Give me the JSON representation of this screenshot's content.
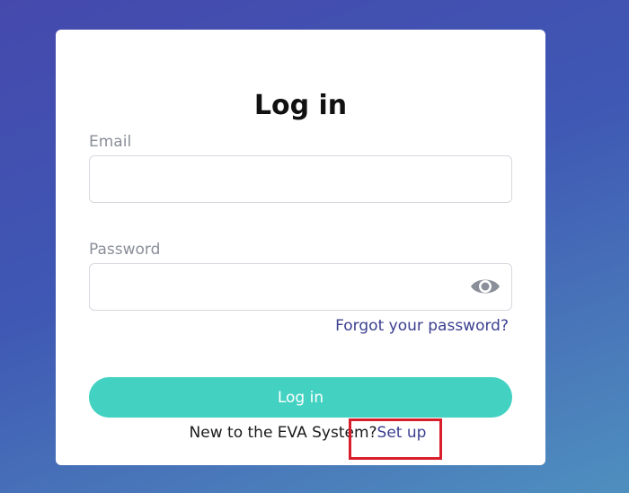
{
  "login": {
    "title": "Log in",
    "email_label": "Email",
    "email_value": "",
    "password_label": "Password",
    "password_value": "",
    "forgot_link": "Forgot your password?",
    "submit_label": "Log in",
    "signup_prompt": "New to the EVA System?",
    "signup_link": "Set up"
  },
  "icons": {
    "password_toggle": "eye-icon"
  },
  "colors": {
    "button": "#43d2c2",
    "link": "#3b3f8f",
    "highlight": "#d81e2a",
    "label": "#8a8f99"
  }
}
